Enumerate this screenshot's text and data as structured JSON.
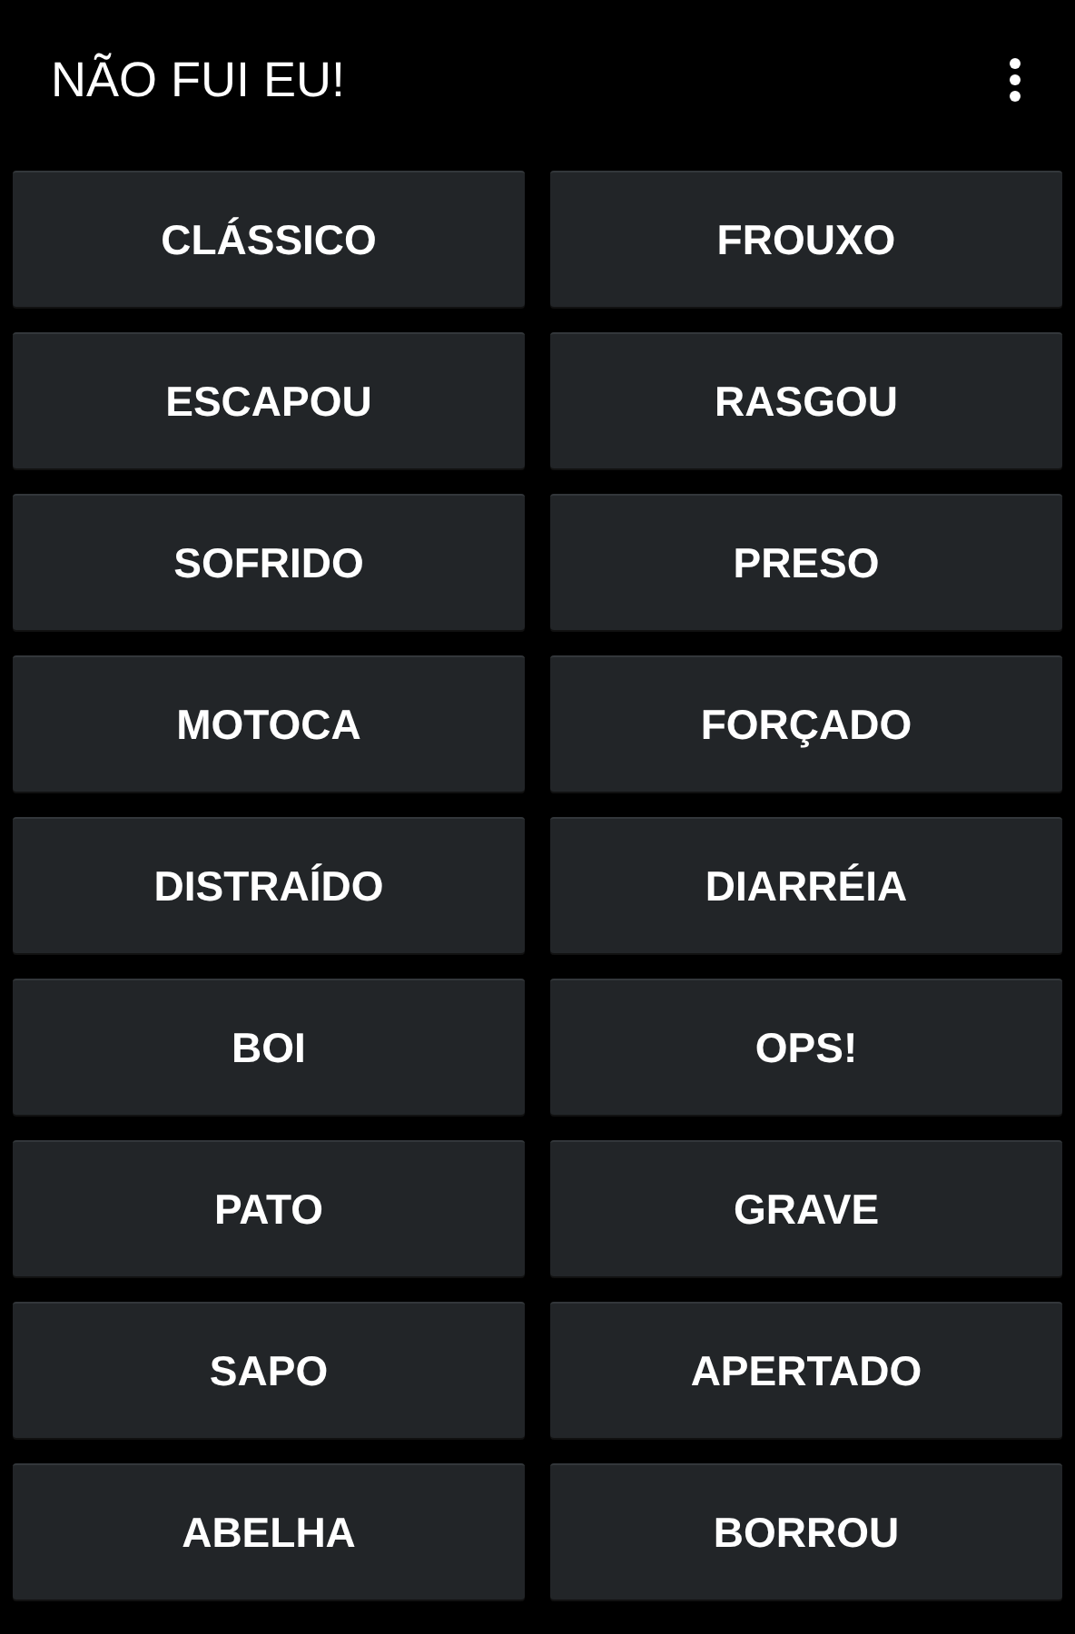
{
  "app_bar": {
    "title": "NÃO FUI EU!"
  },
  "buttons": [
    {
      "label": "CLÁSSICO"
    },
    {
      "label": "FROUXO"
    },
    {
      "label": "ESCAPOU"
    },
    {
      "label": "RASGOU"
    },
    {
      "label": "SOFRIDO"
    },
    {
      "label": "PRESO"
    },
    {
      "label": "MOTOCA"
    },
    {
      "label": "FORÇADO"
    },
    {
      "label": "DISTRAÍDO"
    },
    {
      "label": "DIARRÉIA"
    },
    {
      "label": "BOI"
    },
    {
      "label": "OPS!"
    },
    {
      "label": "PATO"
    },
    {
      "label": "GRAVE"
    },
    {
      "label": "SAPO"
    },
    {
      "label": "APERTADO"
    },
    {
      "label": "ABELHA"
    },
    {
      "label": "BORROU"
    }
  ]
}
